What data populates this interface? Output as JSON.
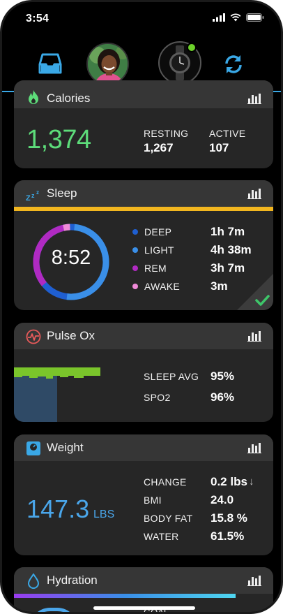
{
  "status_bar": {
    "time": "3:54"
  },
  "calories": {
    "title": "Calories",
    "total": "1,374",
    "resting_label": "RESTING",
    "resting_value": "1,267",
    "active_label": "ACTIVE",
    "active_value": "107"
  },
  "sleep": {
    "title": "Sleep",
    "total": "8:52",
    "stages": [
      {
        "label": "DEEP",
        "value": "1h 7m",
        "color": "#1f5fd1"
      },
      {
        "label": "LIGHT",
        "value": "4h 38m",
        "color": "#3a8fe8"
      },
      {
        "label": "REM",
        "value": "3h 7m",
        "color": "#b02ac2"
      },
      {
        "label": "AWAKE",
        "value": "3m",
        "color": "#f08ad8"
      }
    ]
  },
  "pulse_ox": {
    "title": "Pulse Ox",
    "sleep_avg_label": "SLEEP AVG",
    "sleep_avg_value": "95%",
    "spo2_label": "SPO2",
    "spo2_value": "96%"
  },
  "weight": {
    "title": "Weight",
    "value": "147.3",
    "unit": "LBS",
    "rows": [
      {
        "label": "CHANGE",
        "value": "0.2 lbs"
      },
      {
        "label": "BMI",
        "value": "24.0"
      },
      {
        "label": "BODY FAT",
        "value": "15.8 %"
      },
      {
        "label": "WATER",
        "value": "61.5%"
      }
    ],
    "change_arrow": "↓"
  },
  "hydration": {
    "title": "Hydration",
    "goal_label": "GOAL"
  },
  "colors": {
    "accent_blue": "#3aa8e6",
    "calories_green": "#5ddc7a",
    "weight_blue": "#4aa6ea",
    "sleep_bar": "#f2b61f",
    "check_green": "#3ec76a",
    "pulse_green": "#7ac52b"
  },
  "icons": {
    "inbox": "inbox-tray-icon",
    "sync": "sync-icon",
    "calories": "flame-icon",
    "sleep": "zzz-icon",
    "pulse_ox": "pulse-ox-icon",
    "weight": "scale-icon",
    "hydration": "water-drop-icon",
    "report": "bar-chart-icon"
  }
}
